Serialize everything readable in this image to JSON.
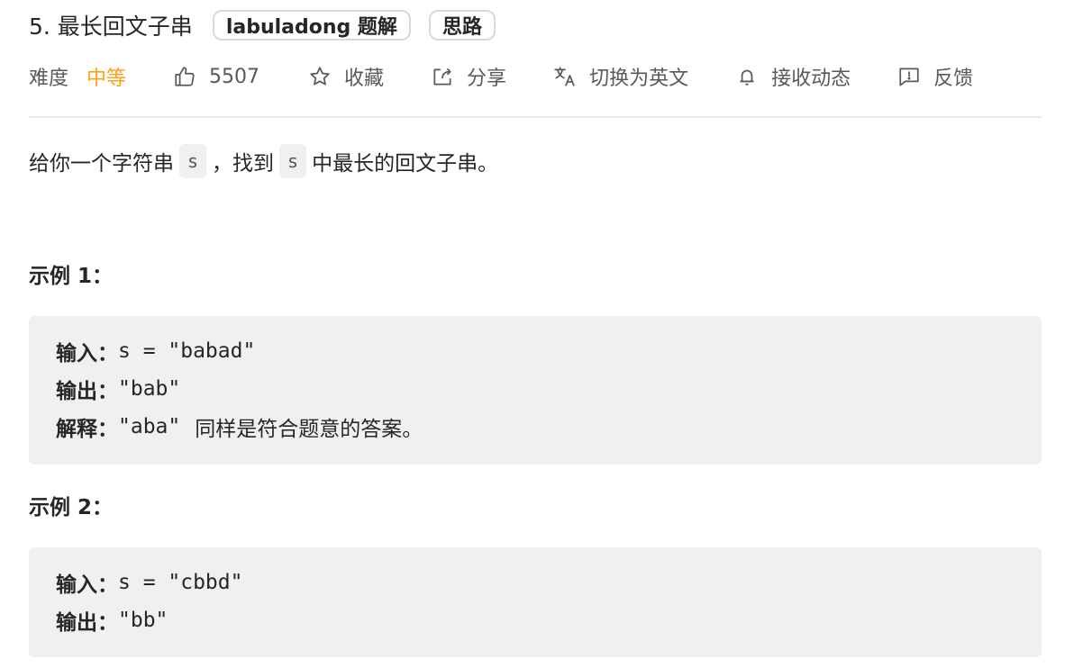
{
  "problem": {
    "title": "5. 最长回文子串",
    "tags": [
      "labuladong 题解",
      "思路"
    ]
  },
  "meta": {
    "difficulty_label": "难度",
    "difficulty_value": "中等",
    "likes": "5507",
    "favorite_label": "收藏",
    "share_label": "分享",
    "switch_lang_label": "切换为英文",
    "subscribe_label": "接收动态",
    "feedback_label": "反馈",
    "colors": {
      "difficulty_medium": "#ffa116",
      "text_secondary": "#595959"
    }
  },
  "description": {
    "part1": "给你一个字符串",
    "code1": "s",
    "part2": "，找到",
    "code2": "s",
    "part3": "中最长的回文子串。"
  },
  "examples": [
    {
      "title_prefix": "示例",
      "title_num": "1",
      "title_suffix": "：",
      "input_label": "输入：",
      "input_value": "s = \"babad\"",
      "output_label": "输出：",
      "output_value": "\"bab\"",
      "explain_label": "解释：",
      "explain_code": "\"aba\"",
      "explain_text": "同样是符合题意的答案。"
    },
    {
      "title_prefix": "示例",
      "title_num": "2",
      "title_suffix": "：",
      "input_label": "输入：",
      "input_value": "s = \"cbbd\"",
      "output_label": "输出：",
      "output_value": "\"bb\""
    }
  ],
  "icons": {
    "like": "thumbs-up-icon",
    "favorite": "star-icon",
    "share": "share-icon",
    "translate": "translate-icon",
    "subscribe": "bell-icon",
    "feedback": "feedback-icon"
  }
}
